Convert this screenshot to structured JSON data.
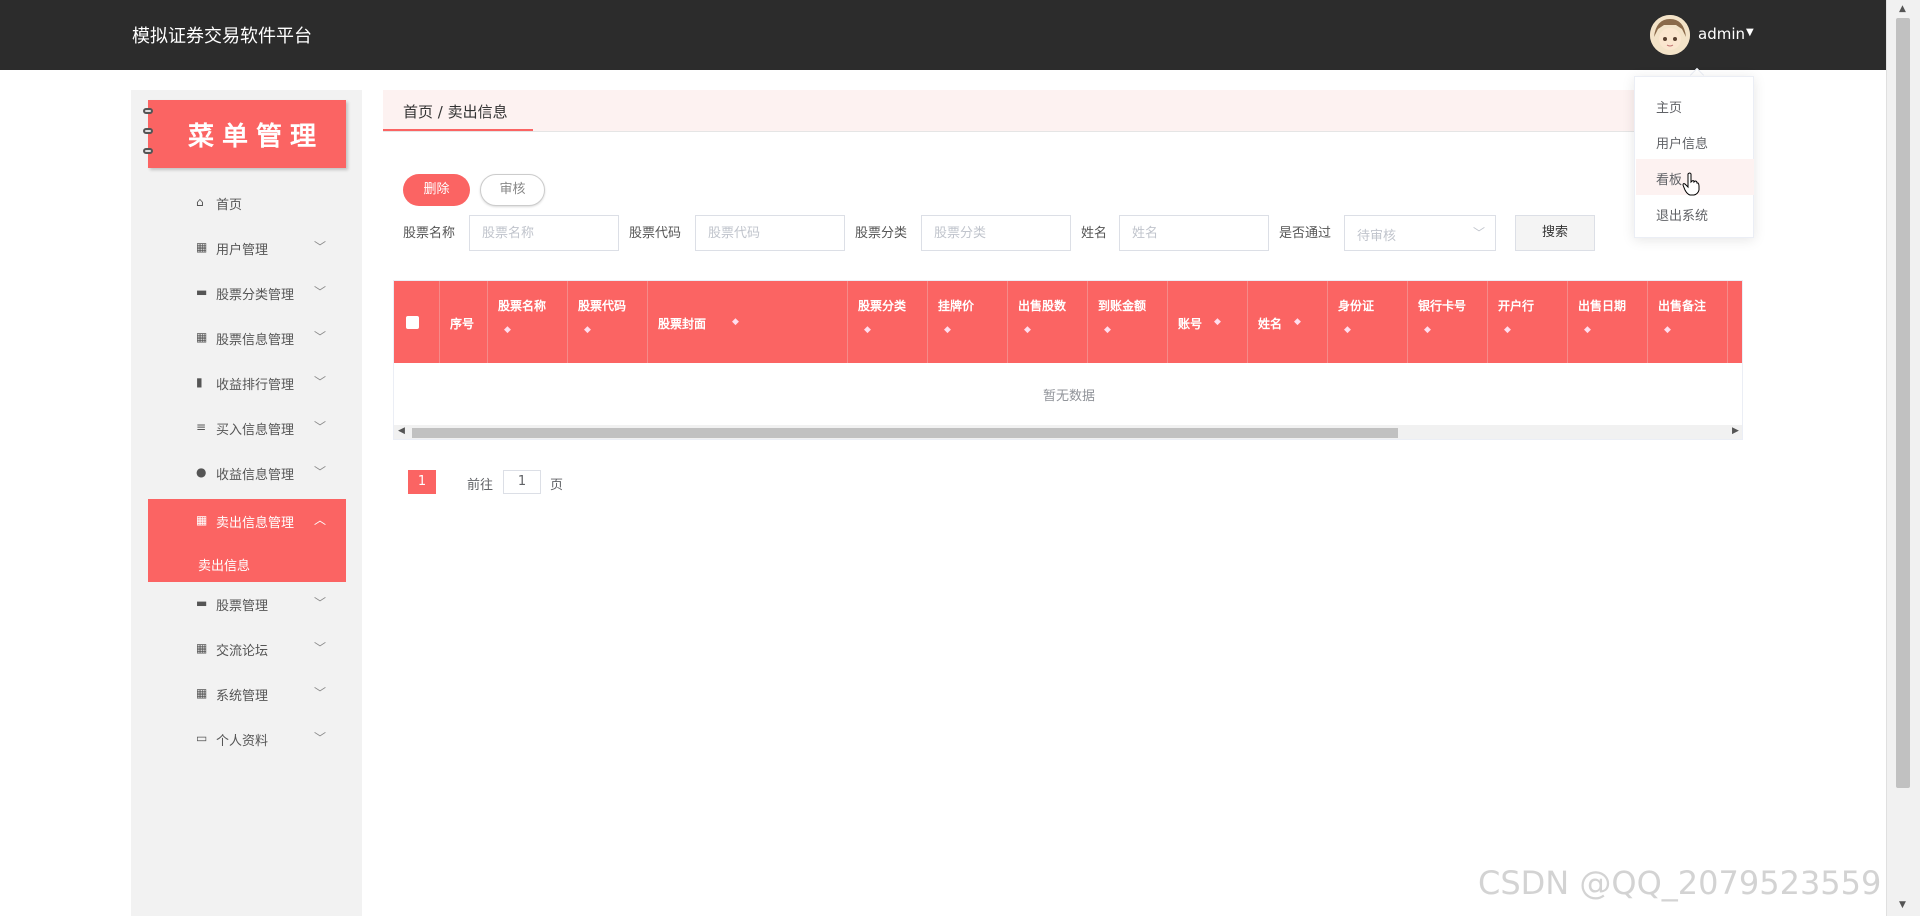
{
  "app": {
    "title": "模拟证券交易软件平台",
    "user": "admin"
  },
  "user_menu": {
    "items": [
      {
        "label": "主页"
      },
      {
        "label": "用户信息"
      },
      {
        "label": "看板"
      },
      {
        "label": "退出系统"
      }
    ]
  },
  "sidebar": {
    "banner": "菜单管理",
    "items": [
      {
        "label": "首页",
        "icon": "home-icon"
      },
      {
        "label": "用户管理",
        "icon": "grid-icon"
      },
      {
        "label": "股票分类管理",
        "icon": "print-icon"
      },
      {
        "label": "股票信息管理",
        "icon": "grid-icon"
      },
      {
        "label": "收益排行管理",
        "icon": "chart-icon"
      },
      {
        "label": "买入信息管理",
        "icon": "sliders-icon"
      },
      {
        "label": "收益信息管理",
        "icon": "pin-icon"
      },
      {
        "label": "卖出信息管理",
        "icon": "grid-icon"
      },
      {
        "label": "股票管理",
        "icon": "chat-icon"
      },
      {
        "label": "交流论坛",
        "icon": "grid-icon"
      },
      {
        "label": "系统管理",
        "icon": "grid-icon"
      },
      {
        "label": "个人资料",
        "icon": "card-icon"
      }
    ],
    "sub_item": "卖出信息"
  },
  "breadcrumb": "首页 / 卖出信息",
  "toolbar": {
    "delete": "删除",
    "audit": "审核"
  },
  "filters": {
    "stock_name": {
      "label": "股票名称",
      "placeholder": "股票名称"
    },
    "stock_code": {
      "label": "股票代码",
      "placeholder": "股票代码"
    },
    "stock_category": {
      "label": "股票分类",
      "placeholder": "股票分类"
    },
    "name": {
      "label": "姓名",
      "placeholder": "姓名"
    },
    "approved": {
      "label": "是否通过",
      "placeholder": "待审核"
    },
    "search": "搜索"
  },
  "table": {
    "columns": [
      "序号",
      "股票名称",
      "股票代码",
      "股票封面",
      "股票分类",
      "挂牌价",
      "出售股数",
      "到账金额",
      "账号",
      "姓名",
      "身份证",
      "银行卡号",
      "开户行",
      "出售日期",
      "出售备注"
    ],
    "empty": "暂无数据"
  },
  "pagination": {
    "current": "1",
    "goto_label": "前往",
    "goto_value": "1",
    "goto_suffix": "页"
  },
  "watermark": "CSDN @QQ_2079523559",
  "colors": {
    "accent": "#fb6463",
    "topbar": "#2c2c2c"
  }
}
